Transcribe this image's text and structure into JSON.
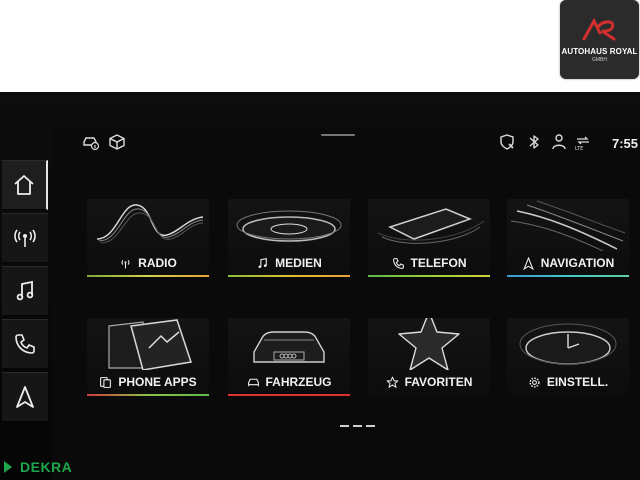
{
  "dealer": {
    "name": "AUTOHAUS ROYAL",
    "sub": "GMBH"
  },
  "status": {
    "time": "7:55"
  },
  "sidebar": {
    "items": [
      {
        "icon": "home-icon"
      },
      {
        "icon": "radio-antenna-icon"
      },
      {
        "icon": "music-note-icon"
      },
      {
        "icon": "phone-icon"
      },
      {
        "icon": "navigation-arrow-icon"
      }
    ]
  },
  "tiles": [
    {
      "label": "RADIO",
      "icon": "radio-antenna-icon",
      "color": "#c8d24a"
    },
    {
      "label": "MEDIEN",
      "icon": "music-note-icon",
      "color": "#e0c030"
    },
    {
      "label": "TELEFON",
      "icon": "phone-icon",
      "color": "#9cd03a"
    },
    {
      "label": "NAVIGATION",
      "icon": "navigation-arrow-icon",
      "color": "#43c7c7"
    },
    {
      "label": "PHONE APPS",
      "icon": "phone-apps-icon",
      "color": "#8bc34a"
    },
    {
      "label": "FAHRZEUG",
      "icon": "car-icon",
      "color": "#e03030"
    },
    {
      "label": "FAVORITEN",
      "icon": "star-icon",
      "color": ""
    },
    {
      "label": "EINSTELL.",
      "icon": "gear-icon",
      "color": ""
    }
  ],
  "watermark": {
    "text": "DEKRA"
  }
}
